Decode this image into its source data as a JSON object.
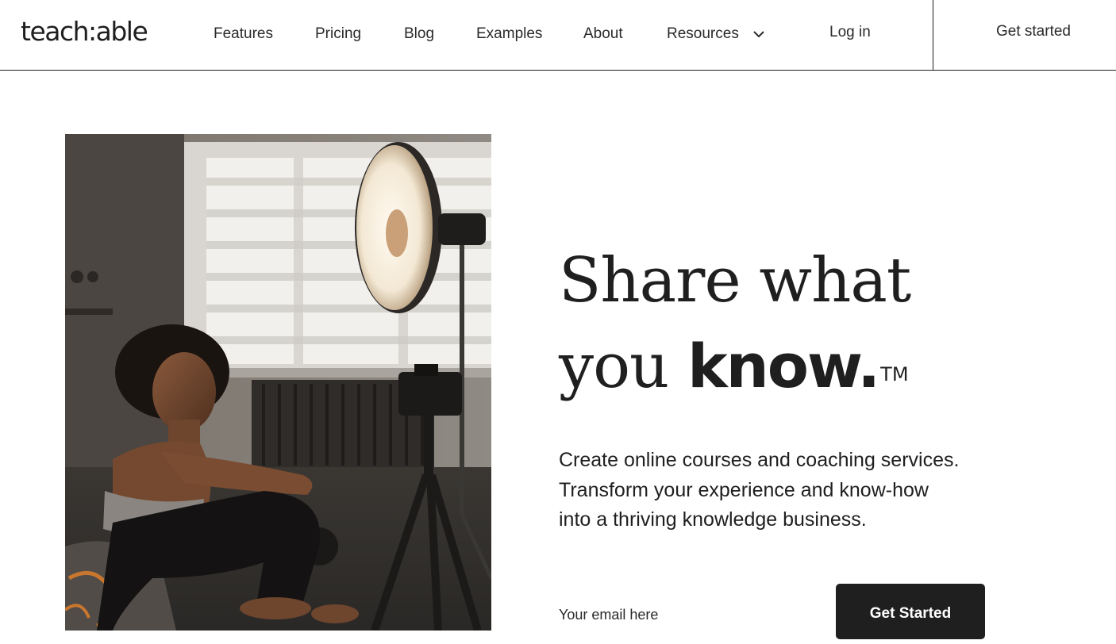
{
  "header": {
    "logo_text": "teach:able",
    "nav": [
      {
        "label": "Features"
      },
      {
        "label": "Pricing"
      },
      {
        "label": "Blog"
      },
      {
        "label": "Examples"
      },
      {
        "label": "About"
      },
      {
        "label": "Resources"
      }
    ],
    "login_label": "Log in",
    "get_started_label": "Get started"
  },
  "hero": {
    "headline_line1": "Share what",
    "headline_line2_prefix": "you ",
    "headline_bold_word": "know.",
    "trademark": "TM",
    "subtext": "Create online courses and coaching services. Transform your experience and know-how into a thriving knowledge business.",
    "email_placeholder": "Your email here",
    "cta_label": "Get Started"
  },
  "colors": {
    "text": "#1f1f1f",
    "button_bg": "#1f1f1f",
    "button_text": "#ffffff",
    "background": "#ffffff"
  }
}
